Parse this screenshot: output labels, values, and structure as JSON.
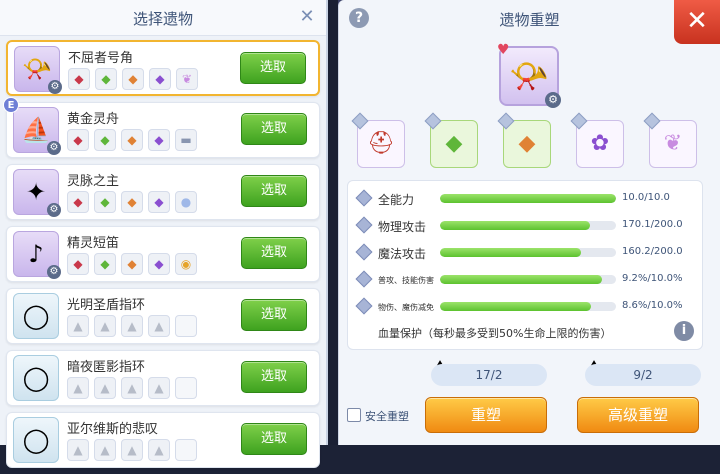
{
  "left": {
    "title": "选择遗物",
    "close_icon": "close-icon",
    "items": [
      {
        "name": "不屈者号角",
        "icon": "horn-icon",
        "gems": [
          "red",
          "green",
          "orange",
          "purple",
          "wings"
        ],
        "button": "选取",
        "selected": true,
        "badge": ""
      },
      {
        "name": "黄金灵舟",
        "icon": "boat-icon",
        "gems": [
          "red",
          "green",
          "orange",
          "purple",
          "ingot"
        ],
        "button": "选取",
        "selected": false,
        "badge": "E"
      },
      {
        "name": "灵脉之主",
        "icon": "staff-icon",
        "gems": [
          "red",
          "green",
          "orange",
          "purple",
          "egg"
        ],
        "button": "选取",
        "selected": false,
        "badge": ""
      },
      {
        "name": "精灵短笛",
        "icon": "flute-icon",
        "gems": [
          "red",
          "green",
          "orange",
          "purple",
          "coin"
        ],
        "button": "选取",
        "selected": false,
        "badge": ""
      },
      {
        "name": "光明圣盾指环",
        "icon": "ring-icon",
        "gems": [
          "grey",
          "grey",
          "grey",
          "grey",
          "empty"
        ],
        "button": "选取",
        "selected": false,
        "badge": ""
      },
      {
        "name": "暗夜匿影指环",
        "icon": "ring-icon",
        "gems": [
          "grey",
          "grey",
          "grey",
          "grey",
          "empty"
        ],
        "button": "选取",
        "selected": false,
        "badge": ""
      },
      {
        "name": "亚尔维斯的悲叹",
        "icon": "ring-icon",
        "gems": [
          "grey",
          "grey",
          "grey",
          "grey",
          "empty"
        ],
        "button": "选取",
        "selected": false,
        "badge": ""
      }
    ]
  },
  "right": {
    "title": "遗物重塑",
    "help_icon": "help-icon",
    "close_icon": "close-icon",
    "main_relic_icon": "horn-icon",
    "sockets": [
      {
        "icon": "helmet-icon",
        "style": "purple"
      },
      {
        "icon": "green-gem-icon",
        "style": "green"
      },
      {
        "icon": "orange-stone-icon",
        "style": "green"
      },
      {
        "icon": "spool-icon",
        "style": "purple"
      },
      {
        "icon": "wings-icon",
        "style": "purple"
      }
    ],
    "stats": [
      {
        "label": "全能力",
        "value": "10.0/10.0",
        "fill": 1.0,
        "small": false
      },
      {
        "label": "物理攻击",
        "value": "170.1/200.0",
        "fill": 0.85,
        "small": false
      },
      {
        "label": "魔法攻击",
        "value": "160.2/200.0",
        "fill": 0.8,
        "small": false
      },
      {
        "label": "普攻、技能伤害",
        "value": "9.2%/10.0%",
        "fill": 0.92,
        "small": true
      },
      {
        "label": "物伤、魔伤减免",
        "value": "8.6%/10.0%",
        "fill": 0.86,
        "small": true
      }
    ],
    "protection": "血量保护（每秒最多受到50%生命上限的伤害）",
    "materials": [
      {
        "count": "17/2",
        "icon": "dust-pile-icon"
      },
      {
        "count": "9/2",
        "icon": "dust-pile-icon"
      }
    ],
    "safe_label": "安全重塑",
    "reshape_button": "重塑",
    "advanced_button": "高级重塑"
  }
}
